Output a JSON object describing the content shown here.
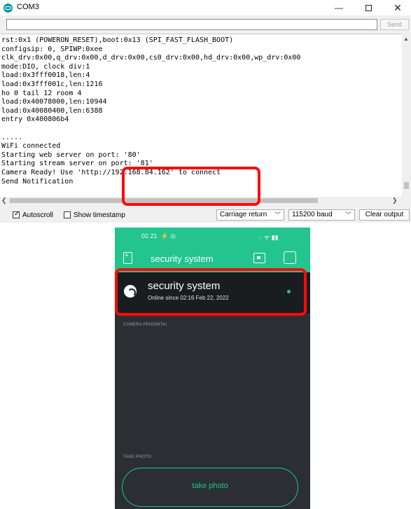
{
  "serial_monitor": {
    "title": "COM3",
    "window_controls": {
      "minimize": "—",
      "close": "✕"
    },
    "send_input_value": "",
    "send_label": "Send",
    "output_lines": [
      "rst:0x1 (POWERON_RESET),boot:0x13 (SPI_FAST_FLASH_BOOT)",
      "configsip: 0, SPIWP:0xee",
      "clk_drv:0x00,q_drv:0x00,d_drv:0x00,cs0_drv:0x00,hd_drv:0x00,wp_drv:0x00",
      "mode:DIO, clock div:1",
      "load:0x3fff0018,len:4",
      "load:0x3fff001c,len:1216",
      "ho 0 tail 12 room 4",
      "load:0x40078000,len:10944",
      "load:0x40080400,len:6388",
      "entry 0x400806b4",
      "",
      ".....",
      "WiFi connected",
      "Starting web server on port: '80'",
      "Starting stream server on port: '81'",
      "Camera Ready! Use 'http://192.168.84.162' to connect",
      "Send Notification"
    ],
    "autoscroll": {
      "label": "Autoscroll",
      "checked": true
    },
    "timestamp": {
      "label": "Show timestamp",
      "checked": false
    },
    "line_ending": "Carriage return",
    "baud": "115200 baud",
    "clear_label": "Clear output",
    "highlight_color": "#ff0a0a"
  },
  "phone": {
    "status_time": "02.21",
    "status_time_icons": "⚡ ◎",
    "status_right": "◌ ᯤ ▮▮",
    "app_title": "security system",
    "device": {
      "name": "security system",
      "status": "Online since 02:16 Feb 22, 2022",
      "online": true
    },
    "sections": {
      "camera": "CAMERA PENGINTAI",
      "take_photo": "TAKE PHOTO"
    },
    "take_photo_button": "take photo",
    "accent_color": "#23c48e",
    "background_color": "#2b2f33"
  }
}
